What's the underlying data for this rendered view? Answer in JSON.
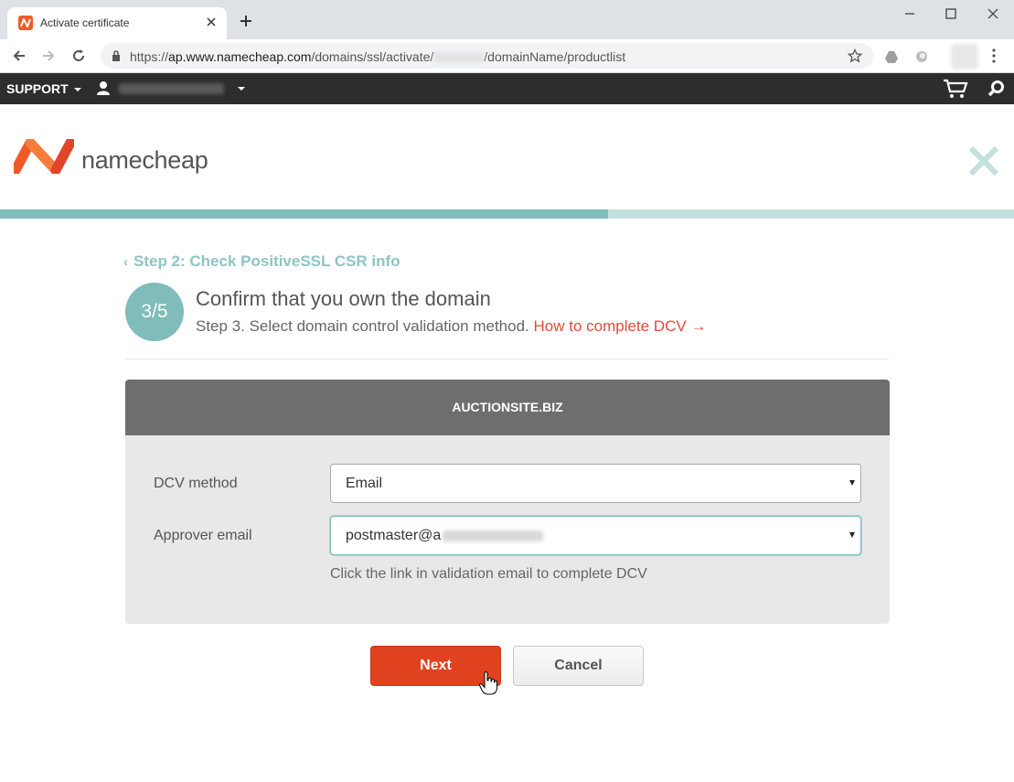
{
  "browser": {
    "tab_title": "Activate certificate",
    "url_scheme": "https://",
    "url_host": "ap.www.namecheap.com",
    "url_path_1": "/domains/ssl/activate/",
    "url_path_2": "/domainName/productlist"
  },
  "site_nav": {
    "support_label": "SUPPORT"
  },
  "header": {
    "brand_name": "namecheap"
  },
  "wizard": {
    "progress_fraction": 0.6,
    "back_link": "Step 2: Check PositiveSSL CSR info",
    "step_badge": "3/5",
    "title": "Confirm that you own the domain",
    "subtitle": "Step 3. Select domain control validation method.",
    "help_link": "How to complete DCV →"
  },
  "panel": {
    "domain": "AUCTIONSITE.BIZ",
    "dcv_label": "DCV method",
    "dcv_value": "Email",
    "approver_label": "Approver email",
    "approver_value": "postmaster@a",
    "hint": "Click the link in validation email to complete DCV"
  },
  "buttons": {
    "next": "Next",
    "cancel": "Cancel"
  },
  "colors": {
    "brand_orange": "#f05a28",
    "teal": "#7fbcba",
    "next_red": "#e0421f"
  }
}
